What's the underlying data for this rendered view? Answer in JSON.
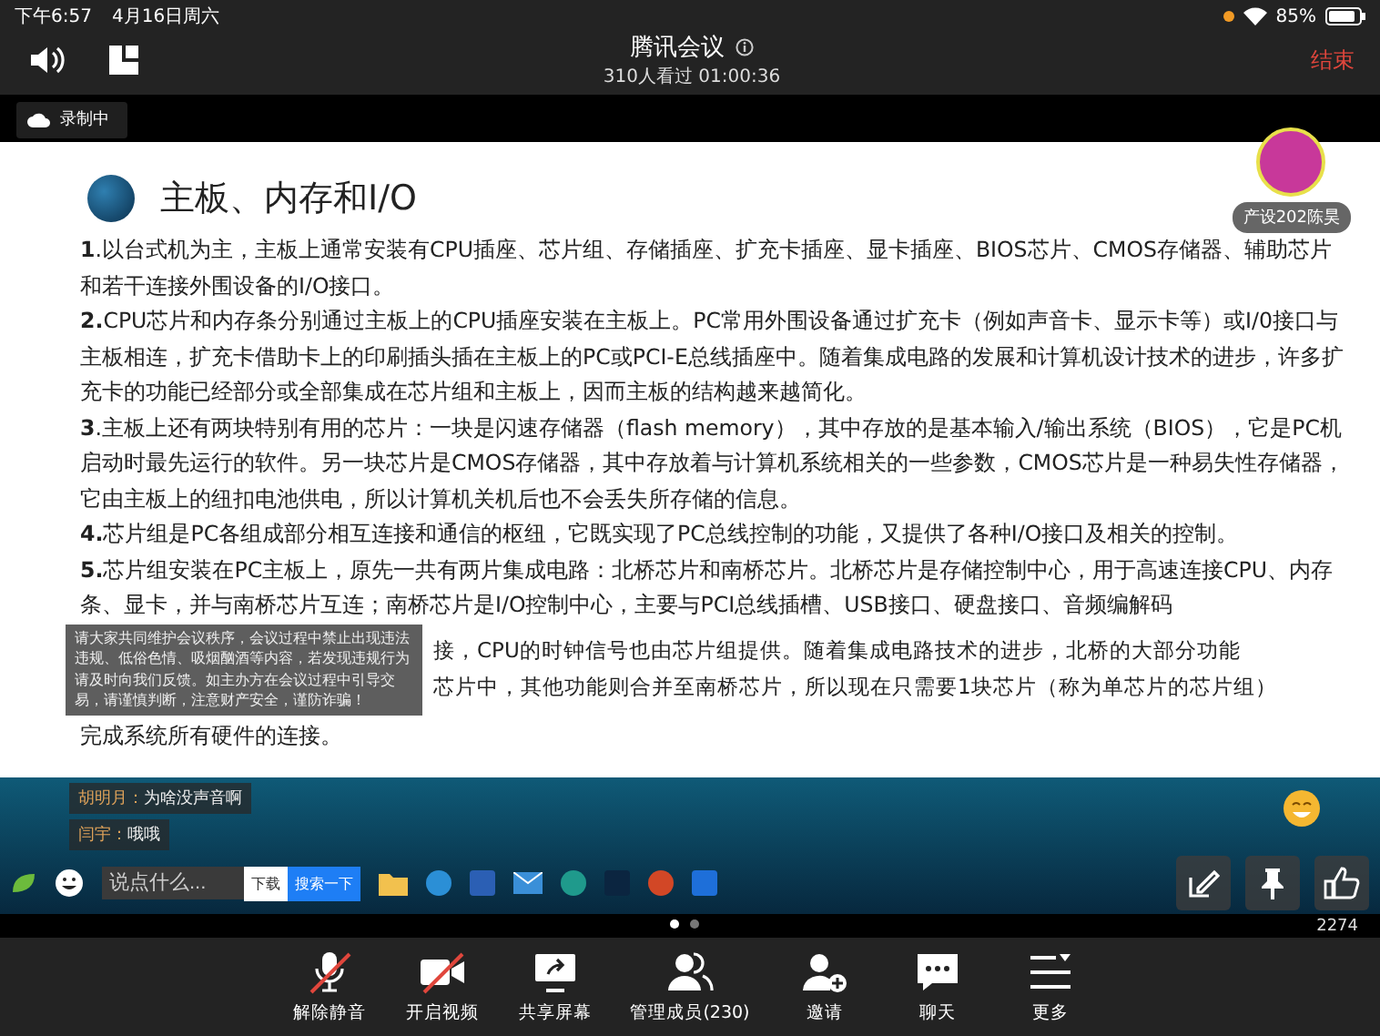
{
  "status_bar": {
    "time": "下午6:57",
    "date": "4月16日周六",
    "battery": "85%"
  },
  "header": {
    "title": "腾讯会议",
    "subtitle": "310人看过  01:00:36",
    "end": "结束"
  },
  "recording": {
    "label": "录制中"
  },
  "presenter": {
    "name": "产设202陈昊"
  },
  "slide": {
    "title": "主板、内存和I/O",
    "paragraphs": [
      "**1**.以台式机为主，主板上通常安装有CPU插座、芯片组、存储插座、扩充卡插座、显卡插座、BIOS芯片、CMOS存储器、辅助芯片和若干连接外围设备的I/O接口。",
      "**2.**CPU芯片和内存条分别通过主板上的CPU插座安装在主板上。PC常用外围设备通过扩充卡（例如声音卡、显示卡等）或I/0接口与主板相连，扩充卡借助卡上的印刷插头插在主板上的PC或PCI-E总线插座中。随着集成电路的发展和计算机设计技术的进步，许多扩充卡的功能已经部分或全部集成在芯片组和主板上，因而主板的结构越来越简化。",
      "**3**.主板上还有两块特别有用的芯片：一块是闪速存储器（flash memory），其中存放的是基本输入/输出系统（BIOS），它是PC机启动时最先运行的软件。另一块芯片是CMOS存储器，其中存放着与计算机系统相关的一些参数，CMOS芯片是一种易失性存储器，它由主板上的纽扣电池供电，所以计算机关机后也不会丢失所存储的信息。",
      "**4.**芯片组是PC各组成部分相互连接和通信的枢纽，它既实现了PC总线控制的功能，又提供了各种I/O接口及相关的控制。",
      "**5.**芯片组安装在PC主板上，原先一共有两片集成电路：北桥芯片和南桥芯片。北桥芯片是存储控制中心，用于高速连接CPU、内存条、显卡，并与南桥芯片互连；南桥芯片是I/O控制中心，主要与PCI总线插槽、USB接口、硬盘接口、音频编解码"
    ],
    "covered_lines": [
      "接，CPU的时钟信号也由芯片组提供。随着集成电路技术的进步，北桥的大部分功能",
      "芯片中，其他功能则合并至南桥芯片，所以现在只需要1块芯片（称为单芯片的芯片组）"
    ],
    "last_line": "完成系统所有硬件的连接。"
  },
  "notice": "请大家共同维护会议秩序，会议过程中禁止出现违法违规、低俗色情、吸烟酗酒等内容，若发现违规行为请及时向我们反馈。如主办方在会议过程中引导交易，请谨慎判断，注意财产安全，谨防诈骗！",
  "chat": [
    {
      "sender": "胡明月：",
      "text": "为啥没声音啊"
    },
    {
      "sender": "闫宇：",
      "text": "哦哦"
    }
  ],
  "chat_input": {
    "placeholder": "说点什么..."
  },
  "taskbar": {
    "download": "下载",
    "search": "搜索一下",
    "apps": [
      {
        "kind": "folder"
      },
      {
        "kind": "circle",
        "color": "#2b8fd6"
      },
      {
        "kind": "doc",
        "color": "#2b5fb4"
      },
      {
        "kind": "mail",
        "color": "#3a8fd8"
      },
      {
        "kind": "circle",
        "color": "#1f9a8c"
      },
      {
        "kind": "ps"
      },
      {
        "kind": "circle",
        "color": "#d24726"
      },
      {
        "kind": "doc",
        "color": "#1e6fd9"
      }
    ]
  },
  "pages": [
    {
      "selected": true
    },
    {
      "selected": false
    }
  ],
  "likes": "2274",
  "toolbar": [
    {
      "kind": "mic",
      "label": "解除静音",
      "slashed": true
    },
    {
      "kind": "video",
      "label": "开启视频",
      "slashed": true
    },
    {
      "kind": "share",
      "label": "共享屏幕",
      "slashed": false
    },
    {
      "kind": "members",
      "label": "管理成员(230)",
      "slashed": false
    },
    {
      "kind": "invite",
      "label": "邀请",
      "slashed": false
    },
    {
      "kind": "chat",
      "label": "聊天",
      "slashed": false
    },
    {
      "kind": "more",
      "label": "更多",
      "slashed": false
    }
  ]
}
